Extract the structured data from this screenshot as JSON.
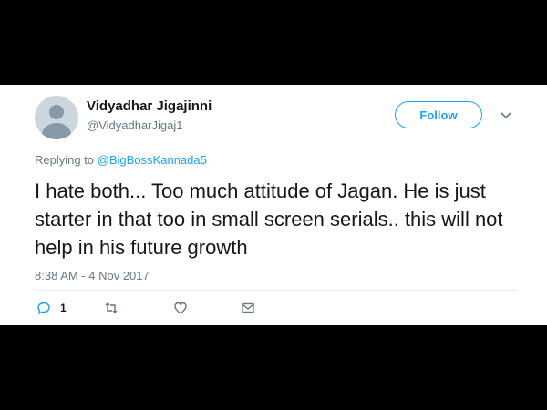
{
  "user": {
    "display_name": "Vidyadhar Jigajinni",
    "handle": "@VidyadharJigaj1"
  },
  "follow_button": {
    "label": "Follow"
  },
  "reply_context": {
    "prefix": "Replying to",
    "mention": "@BigBossKannada5"
  },
  "tweet": {
    "text": "I hate both... Too much attitude of Jagan. He is just starter in that too in small screen serials.. this will not help in his future growth",
    "timestamp": "8:38 AM - 4 Nov 2017"
  },
  "actions": {
    "reply_count": "1",
    "icons": [
      "reply-icon",
      "retweet-icon",
      "like-icon",
      "direct-message-icon"
    ]
  },
  "colors": {
    "accent": "#1da1f2",
    "secondary_text": "#657786",
    "primary_text": "#14171a",
    "background_letterbox": "#000000"
  }
}
